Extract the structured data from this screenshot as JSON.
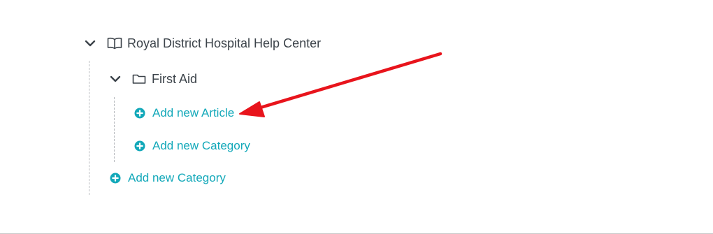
{
  "tree": {
    "root": {
      "label": "Royal District Hospital Help Center",
      "icon": "book-icon",
      "expanded": true
    },
    "category": {
      "label": "First Aid",
      "icon": "folder-icon",
      "expanded": true,
      "add_article_label": "Add new Article",
      "add_category_label": "Add new Category"
    },
    "root_add_category_label": "Add new Category"
  },
  "colors": {
    "accent": "#12a8b9",
    "text": "#3c434a",
    "guide": "#b9bcc0",
    "annotation_arrow": "#e8141c"
  }
}
